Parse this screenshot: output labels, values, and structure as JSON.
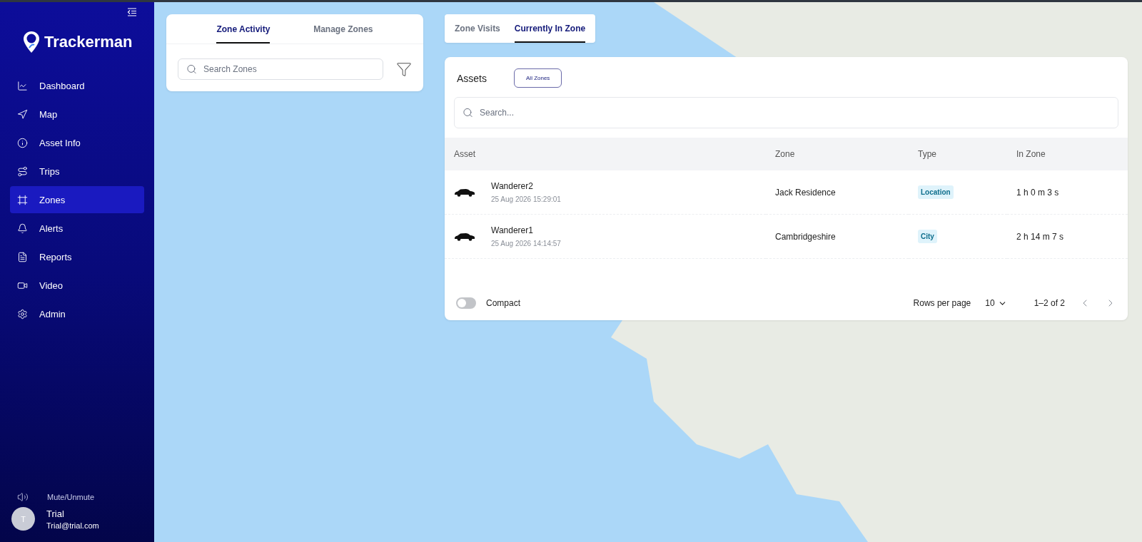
{
  "sidebar": {
    "logo": "Trackerman",
    "items": [
      {
        "label": "Dashboard",
        "selected": false
      },
      {
        "label": "Map",
        "selected": false
      },
      {
        "label": "Asset Info",
        "selected": false
      },
      {
        "label": "Trips",
        "selected": false
      },
      {
        "label": "Zones",
        "selected": true
      },
      {
        "label": "Alerts",
        "selected": false
      },
      {
        "label": "Reports",
        "selected": false
      },
      {
        "label": "Video",
        "selected": false
      },
      {
        "label": "Admin",
        "selected": false
      }
    ],
    "mute": "Mute/Unmute",
    "user": {
      "initial": "T",
      "name": "Trial",
      "email": "Trial@trial.com"
    }
  },
  "zone_panel": {
    "tabs": [
      {
        "label": "Zone Activity",
        "selected": true
      },
      {
        "label": "Manage Zones",
        "selected": false
      }
    ],
    "search": {
      "placeholder": "Search Zones"
    }
  },
  "assets_panel": {
    "tabs": [
      {
        "label": "Zone Visits",
        "selected": false
      },
      {
        "label": "Currently In Zone",
        "selected": true
      }
    ],
    "title": "Assets",
    "filter_button": "All Zones",
    "search": {
      "placeholder": "Search..."
    },
    "columns": [
      "Asset",
      "Zone",
      "Type",
      "In Zone"
    ],
    "rows": [
      {
        "asset": "Wanderer2",
        "time": "25 Aug 2026 15:29:01",
        "zone": "Jack Residence",
        "type": "Location",
        "in_zone": "1 h 0 m 3 s"
      },
      {
        "asset": "Wanderer1",
        "time": "25 Aug 2026 14:14:57",
        "zone": "Cambridgeshire",
        "type": "City",
        "in_zone": "2 h 14 m 7 s"
      }
    ],
    "footer": {
      "compact": {
        "label": "Compact",
        "on": false
      },
      "rows_per_page": "Rows per page",
      "page_size": "10",
      "range": "1–2 of 2"
    }
  }
}
